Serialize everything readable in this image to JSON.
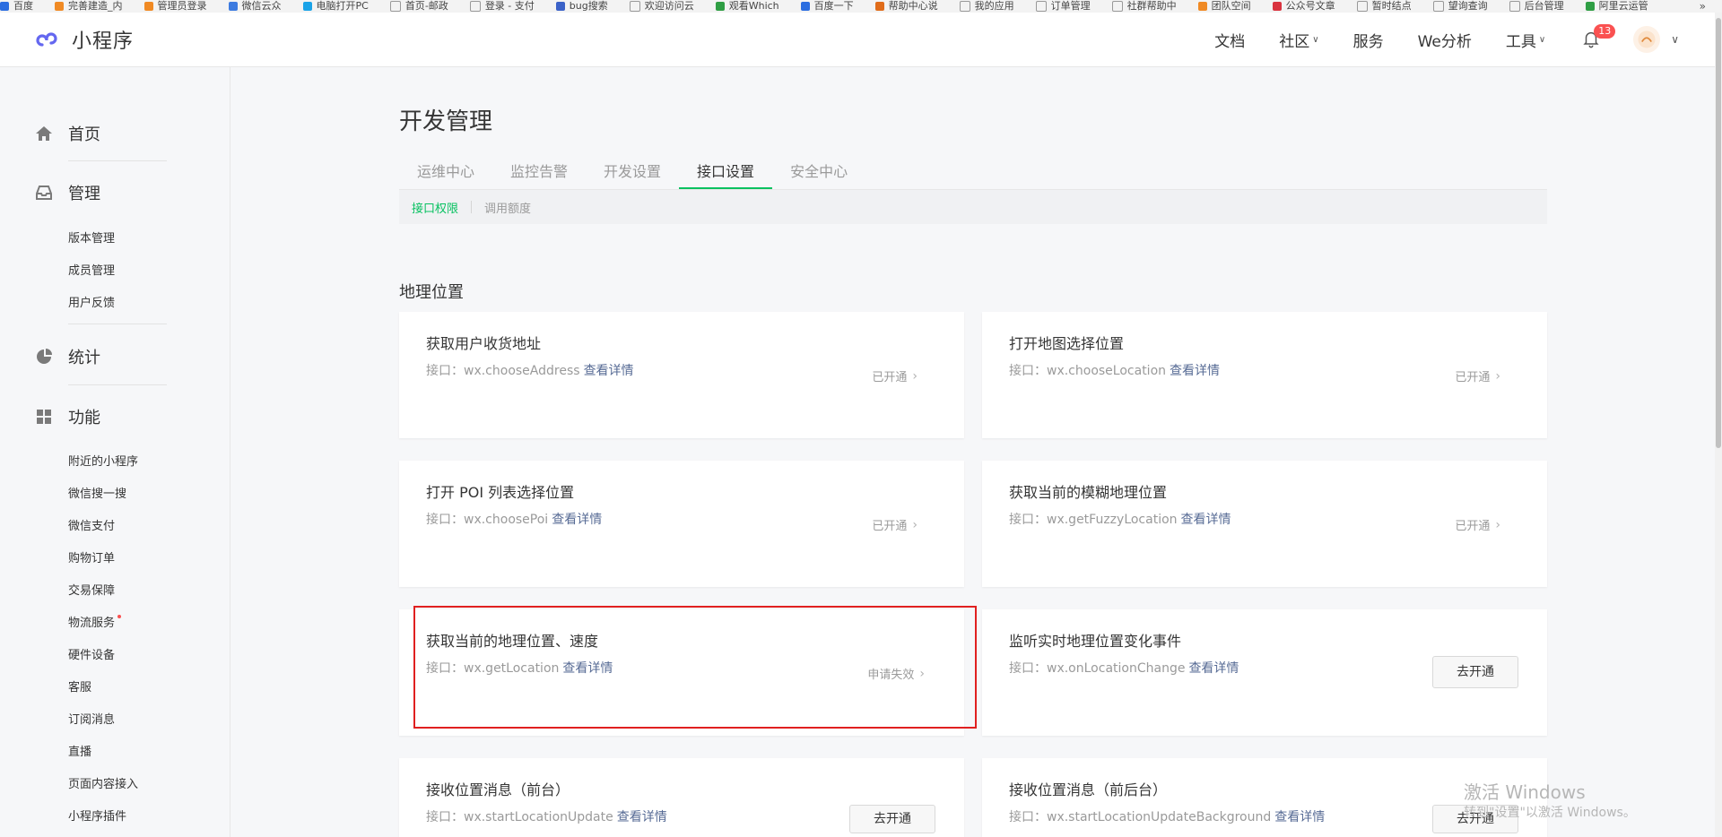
{
  "bookmarks": [
    "百度",
    "完善建造_内",
    "管理员登录",
    "微信云众",
    "电脑打开PC",
    "首页-邮政",
    "登录 - 支付",
    "bug搜索",
    "欢迎访问云",
    "观看Which",
    "百度一下",
    "帮助中心说",
    "我的应用",
    "订单管理",
    "社群帮助中",
    "团队空间",
    "公众号文章",
    "暂时结点",
    "望询查询",
    "后台管理",
    "阿里云运管",
    "»"
  ],
  "colors": {
    "accent": "#07c160",
    "link": "#576b95",
    "badge": "#fa5151",
    "highlight": "#e02020"
  },
  "topnav": {
    "logo_text": "小程序",
    "links": [
      "文档",
      "社区",
      "服务",
      "We分析",
      "工具"
    ],
    "notification_count": "13"
  },
  "sidebar": {
    "home": "首页",
    "manage": {
      "label": "管理",
      "items": [
        "版本管理",
        "成员管理",
        "用户反馈"
      ]
    },
    "stats": "统计",
    "features": {
      "label": "功能",
      "items": [
        "附近的小程序",
        "微信搜一搜",
        "微信支付",
        "购物订单",
        "交易保障",
        "物流服务",
        "硬件设备",
        "客服",
        "订阅消息",
        "直播",
        "页面内容接入",
        "小程序插件"
      ]
    }
  },
  "main": {
    "title": "开发管理",
    "tabs": [
      "运维中心",
      "监控告警",
      "开发设置",
      "接口设置",
      "安全中心"
    ],
    "active_tab": "接口设置",
    "subtabs": [
      "接口权限",
      "调用额度"
    ],
    "section": "地理位置",
    "api_prefix": "接口：",
    "detail_link": "查看详情",
    "cards": [
      {
        "title": "获取用户收货地址",
        "api": "wx.chooseAddress",
        "status": "已开通"
      },
      {
        "title": "打开地图选择位置",
        "api": "wx.chooseLocation",
        "status": "已开通"
      },
      {
        "title": "打开 POI 列表选择位置",
        "api": "wx.choosePoi",
        "status": "已开通"
      },
      {
        "title": "获取当前的模糊地理位置",
        "api": "wx.getFuzzyLocation",
        "status": "已开通"
      },
      {
        "title": "获取当前的地理位置、速度",
        "api": "wx.getLocation",
        "status": "申请失效"
      },
      {
        "title": "监听实时地理位置变化事件",
        "api": "wx.onLocationChange",
        "button": "去开通"
      },
      {
        "title": "接收位置消息（前台）",
        "api": "wx.startLocationUpdate",
        "button": "去开通"
      },
      {
        "title": "接收位置消息（前后台）",
        "api": "wx.startLocationUpdateBackground",
        "button": "去开通"
      }
    ]
  },
  "watermark": {
    "line1": "激活 Windows",
    "line2": "转到\"设置\"以激活 Windows。"
  }
}
